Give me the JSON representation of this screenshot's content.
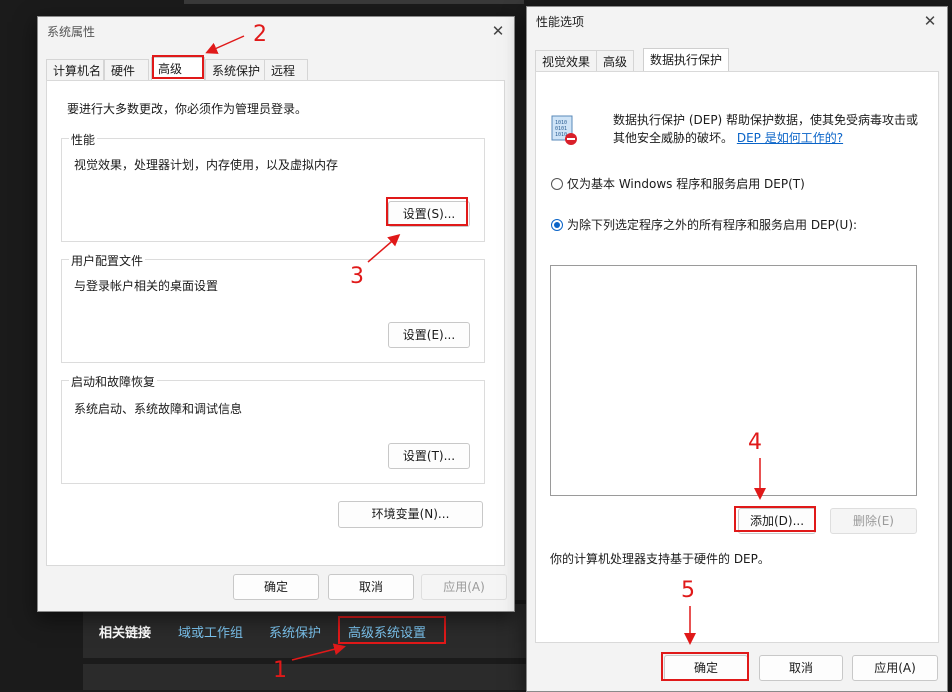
{
  "background": {
    "related_links": {
      "title": "相关链接",
      "links": [
        "域或工作组",
        "系统保护",
        "高级系统设置"
      ]
    }
  },
  "sys_props": {
    "title": "系统属性",
    "tabs": [
      "计算机名",
      "硬件",
      "高级",
      "系统保护",
      "远程"
    ],
    "admin_note": "要进行大多数更改，你必须作为管理员登录。",
    "groups": [
      {
        "label": "性能",
        "desc": "视觉效果，处理器计划，内存使用，以及虚拟内存",
        "button": "设置(S)..."
      },
      {
        "label": "用户配置文件",
        "desc": "与登录帐户相关的桌面设置",
        "button": "设置(E)..."
      },
      {
        "label": "启动和故障恢复",
        "desc": "系统启动、系统故障和调试信息",
        "button": "设置(T)..."
      }
    ],
    "env_button": "环境变量(N)...",
    "ok": "确定",
    "cancel": "取消",
    "apply": "应用(A)"
  },
  "perf_opts": {
    "title": "性能选项",
    "tabs": [
      "视觉效果",
      "高级",
      "数据执行保护"
    ],
    "desc_line1": "数据执行保护 (DEP) 帮助保护数据，使其免受病毒攻击或",
    "desc_line2": "其他安全威胁的破坏。",
    "desc_link": "DEP 是如何工作的?",
    "radio1": "仅为基本 Windows 程序和服务启用 DEP(T)",
    "radio2": "为除下列选定程序之外的所有程序和服务启用 DEP(U):",
    "add_button": "添加(D)...",
    "remove_button": "删除(E)",
    "hw_note": "你的计算机处理器支持基于硬件的 DEP。",
    "ok": "确定",
    "cancel": "取消",
    "apply": "应用(A)"
  },
  "annotations": [
    "1",
    "2",
    "3",
    "4",
    "5"
  ],
  "colors": {
    "annotation": "#e01919",
    "link": "#0a64c8",
    "bg_link": "#7cc4ef"
  }
}
